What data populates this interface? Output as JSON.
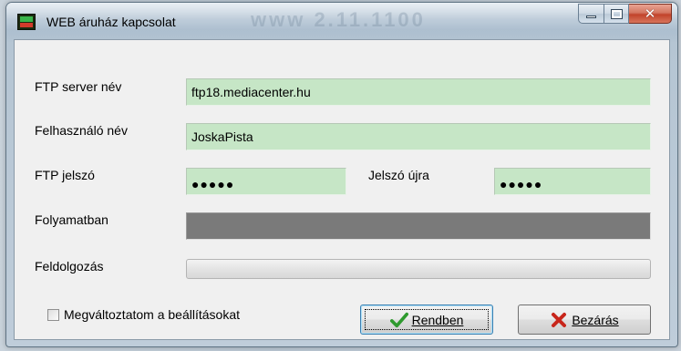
{
  "window": {
    "title": "WEB áruház kapcsolat",
    "background_ghost_text": "www 2.11.1100"
  },
  "form": {
    "ftp_server_label": "FTP server név",
    "ftp_server_value": "ftp18.mediacenter.hu",
    "username_label": "Felhasználó név",
    "username_value": "JoskaPista",
    "ftp_password_label": "FTP jelszó",
    "ftp_password_value": "●●●●●",
    "password_again_label": "Jelszó újra",
    "password_again_value": "●●●●●",
    "in_progress_label": "Folyamatban",
    "processing_label": "Feldolgozás",
    "processing_progress": 0
  },
  "footer": {
    "change_settings_label": "Megváltoztatom a beállításokat",
    "change_settings_checked": false,
    "ok_label": "Rendben",
    "close_label": "Bezárás"
  },
  "colors": {
    "field_background": "#c6e6c6",
    "progress_dark": "#7a7a7a",
    "ok_check_icon": "#2e9a2e",
    "close_x_icon": "#c8261b"
  },
  "icons": {
    "app": "app-icon",
    "minimize": "minimize-icon",
    "maximize": "maximize-icon",
    "close": "close-icon",
    "ok": "checkmark-icon",
    "cancel": "x-mark-icon"
  }
}
